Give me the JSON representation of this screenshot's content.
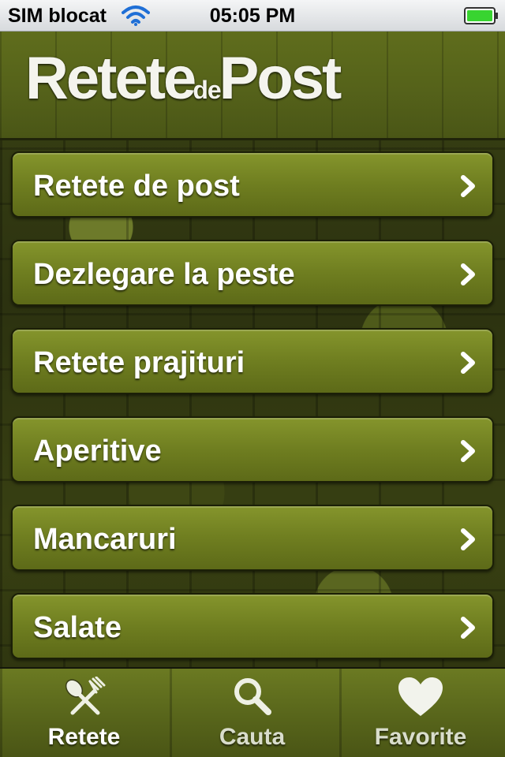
{
  "status_bar": {
    "carrier": "SIM blocat",
    "time": "05:05 PM",
    "wifi_icon": "wifi-icon",
    "battery_icon": "battery-icon",
    "battery_color": "#38d430"
  },
  "header": {
    "logo_part1": "Retete",
    "logo_part2": "de",
    "logo_part3": "Post"
  },
  "menu": {
    "items": [
      {
        "label": "Retete de post",
        "icon": "chevron-right-icon"
      },
      {
        "label": "Dezlegare la peste",
        "icon": "chevron-right-icon"
      },
      {
        "label": "Retete prajituri",
        "icon": "chevron-right-icon"
      },
      {
        "label": "Aperitive",
        "icon": "chevron-right-icon"
      },
      {
        "label": "Mancaruri",
        "icon": "chevron-right-icon"
      },
      {
        "label": "Salate",
        "icon": "chevron-right-icon"
      }
    ]
  },
  "tab_bar": {
    "tabs": [
      {
        "label": "Retete",
        "icon": "fork-spoon-icon"
      },
      {
        "label": "Cauta",
        "icon": "search-icon"
      },
      {
        "label": "Favorite",
        "icon": "heart-icon"
      }
    ]
  },
  "colors": {
    "accent_green": "#6f7e20",
    "text_white": "#ffffff"
  }
}
